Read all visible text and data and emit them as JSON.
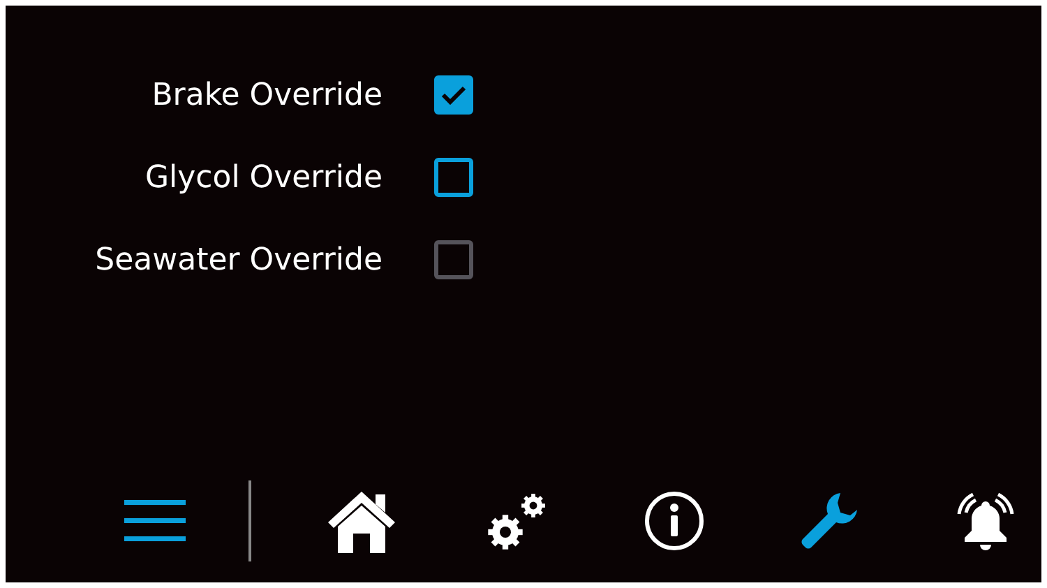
{
  "overrides": [
    {
      "label": "Brake Override",
      "checked": true,
      "disabled": false
    },
    {
      "label": "Glycol Override",
      "checked": false,
      "disabled": false
    },
    {
      "label": "Seawater Override",
      "checked": false,
      "disabled": true
    }
  ],
  "nav": [
    {
      "kind": "menu"
    },
    {
      "kind": "home",
      "selected": false
    },
    {
      "kind": "settings",
      "selected": false
    },
    {
      "kind": "info",
      "selected": false
    },
    {
      "kind": "tools",
      "selected": true
    },
    {
      "kind": "alarm",
      "selected": false
    }
  ]
}
